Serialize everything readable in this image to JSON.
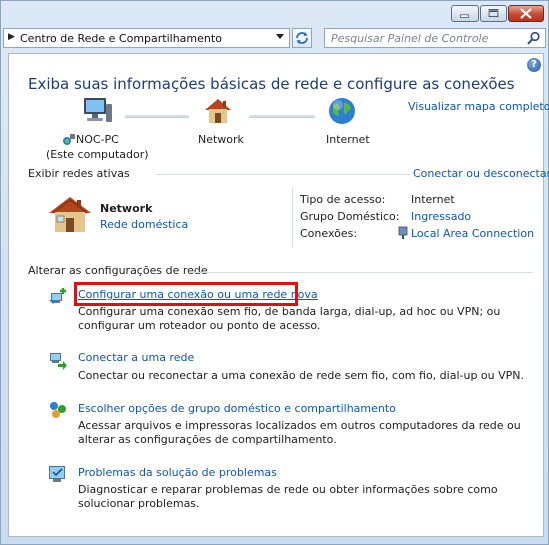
{
  "window": {
    "minimize_icon": "minimize-icon",
    "maximize_icon": "maximize-icon",
    "close_icon": "close-icon"
  },
  "address_bar": {
    "breadcrumb": "Centro de Rede e Compartilhamento",
    "search_placeholder": "Pesquisar Painel de Controle"
  },
  "main": {
    "title": "Exiba suas informações básicas de rede e configure as conexões",
    "view_full_map": "Visualizar mapa completo",
    "map": {
      "computer_name": "NOC-PC",
      "computer_sub": "(Este computador)",
      "network": "Network",
      "internet": "Internet"
    },
    "active_networks": {
      "heading": "Exibir redes ativas",
      "connect_link": "Conectar ou desconectar",
      "network_name": "Network",
      "network_type": "Rede doméstica",
      "access_type_label": "Tipo de acesso:",
      "access_type_value": "Internet",
      "homegroup_label": "Grupo Doméstico:",
      "homegroup_value": "Ingressado",
      "connections_label": "Conexões:",
      "connections_value": "Local Area Connection"
    },
    "change_settings": {
      "heading": "Alterar as configurações de rede",
      "tasks": [
        {
          "title": "Configurar uma conexão ou uma rede nova",
          "desc": "Configurar uma conexão sem fio, de banda larga, dial-up, ad hoc ou VPN; ou configurar um roteador ou ponto de acesso."
        },
        {
          "title": "Conectar a uma rede",
          "desc": "Conectar ou reconectar a uma conexão de rede sem fio, com fio, dial-up ou VPN."
        },
        {
          "title": "Escolher opções de grupo doméstico e compartilhamento",
          "desc": "Acessar arquivos e impressoras localizados em outros computadores da rede ou alterar as configurações de compartilhamento."
        },
        {
          "title": "Problemas da solução de problemas",
          "desc": "Diagnosticar e reparar problemas de rede ou obter informações sobre como solucionar problemas."
        }
      ]
    }
  }
}
